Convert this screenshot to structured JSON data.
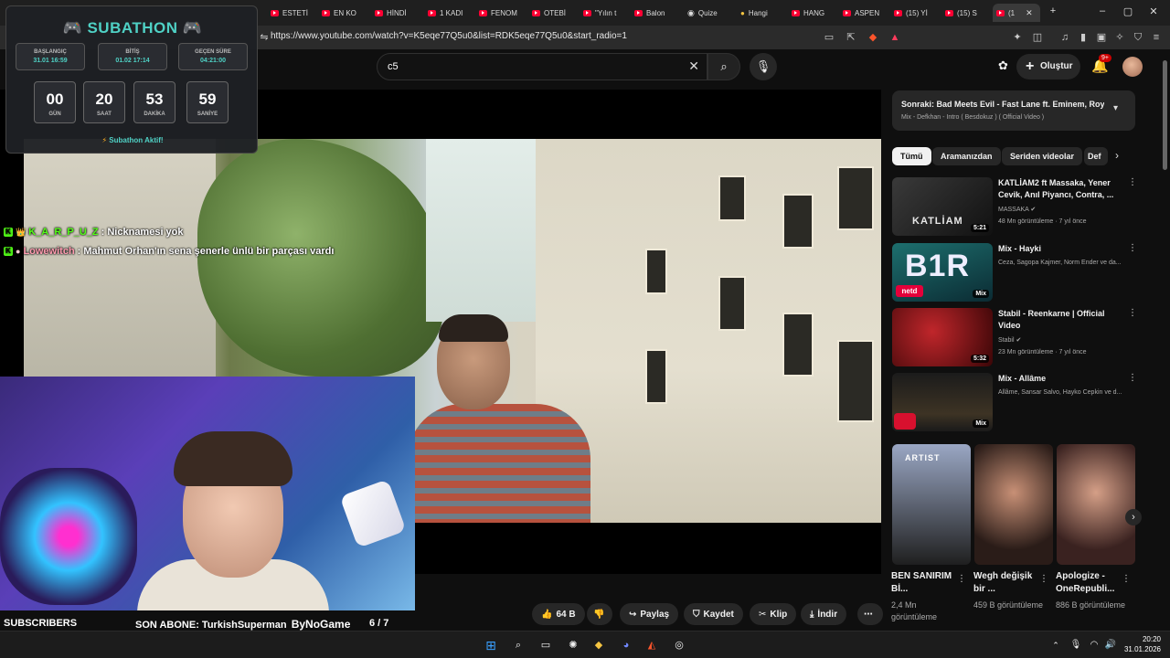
{
  "browser": {
    "tabs": [
      {
        "label": "ESTETİ"
      },
      {
        "label": "EN KO"
      },
      {
        "label": "HİNDİ"
      },
      {
        "label": "1 KADI"
      },
      {
        "label": "FENOM"
      },
      {
        "label": "OTEBİ"
      },
      {
        "label": "\"Yılın t"
      },
      {
        "label": "Balon"
      },
      {
        "label": "Quize"
      },
      {
        "label": "Hangi"
      },
      {
        "label": "HANG"
      },
      {
        "label": "ASPEN"
      },
      {
        "label": "(15) Yİ"
      },
      {
        "label": "(15) S"
      },
      {
        "label": "(1"
      }
    ],
    "url": "https://www.youtube.com/watch?v=K5eqe77Q5u0&list=RDK5eqe77Q5u0&start_radio=1"
  },
  "youtube": {
    "search_value": "c5",
    "create_label": "Oluştur",
    "notif_badge": "9+"
  },
  "subathon": {
    "title": "SUBATHON",
    "start_label": "BAŞLANGIÇ",
    "start_value": "31.01 16:59",
    "end_label": "BİTİŞ",
    "end_value": "01.02 17:14",
    "elapsed_label": "GEÇEN SÜRE",
    "elapsed_value": "04:21:00",
    "countdown": [
      {
        "num": "00",
        "unit": "GÜN"
      },
      {
        "num": "20",
        "unit": "SAAT"
      },
      {
        "num": "53",
        "unit": "DAKİKA"
      },
      {
        "num": "59",
        "unit": "SANİYE"
      }
    ],
    "status": "Subathon Aktif!",
    "accent": "#4fd1c5"
  },
  "chat": [
    {
      "user": "K_A_R_P_U_Z",
      "message": ": Nicknamesi yok",
      "color": "#53fc18"
    },
    {
      "user": "Lowewitch",
      "message": ": Mahmut Orhan'ın sena şenerle ünlü bir parçası vardı",
      "color": "#ff9bb0"
    }
  ],
  "overlay_bottom": {
    "subscribers_label": "SUBSCRIBERS",
    "son_abone": "SON ABONE: TurkishSuperman",
    "by": "ByNoGame",
    "goal_count": "6 / 7",
    "progress": 0.01
  },
  "actions": {
    "likes": "64 B",
    "share": "Paylaş",
    "save": "Kaydet",
    "clip": "Klip",
    "download": "İndir"
  },
  "sidebar": {
    "upnext_title": "Sonraki: Bad Meets Evil - Fast Lane ft. Eminem, Royce da 5'9\"",
    "upnext_sub": "Mix - Defkhan - Intro ( Besdokuz ) ( Official Video )",
    "chips": [
      "Tümü",
      "Aramanızdan",
      "Seriden videolar",
      "Def"
    ],
    "recs": [
      {
        "title": "KATLİAM2 ft Massaka, Yener Cevik, Anıl Piyancı, Contra, ...",
        "channel": "MASSAKA",
        "views": "48 Mn görüntüleme · 7 yıl önce",
        "duration": "5:21",
        "thumb_text": "KATLİAM"
      },
      {
        "title": "Mix - Hayki",
        "channel": "Ceza, Sagopa Kajmer, Norm Ender ve da...",
        "views": "",
        "duration": "Mix",
        "thumb_text": "B1R"
      },
      {
        "title": "Stabil - Reenkarne | Official Video",
        "channel": "Stabil",
        "views": "23 Mn görüntüleme · 7 yıl önce",
        "duration": "5:32",
        "thumb_text": ""
      },
      {
        "title": "Mix - Allâme",
        "channel": "Allâme, Sansar Salvo, Hayko Cepkin ve d...",
        "views": "",
        "duration": "Mix",
        "thumb_text": ""
      }
    ],
    "shorts": [
      {
        "title": "BEN SANIRIM Bİ...",
        "views": "2,4 Mn görüntüleme",
        "badge": "ARTIST"
      },
      {
        "title": "Wegh değişik bir ...",
        "views": "459 B görüntüleme",
        "badge": ""
      },
      {
        "title": "Apologize - OneRepubli...",
        "views": "886 B görüntüleme",
        "badge": ""
      }
    ]
  },
  "clock": {
    "time": "20:20",
    "date": "31.01.2026"
  }
}
